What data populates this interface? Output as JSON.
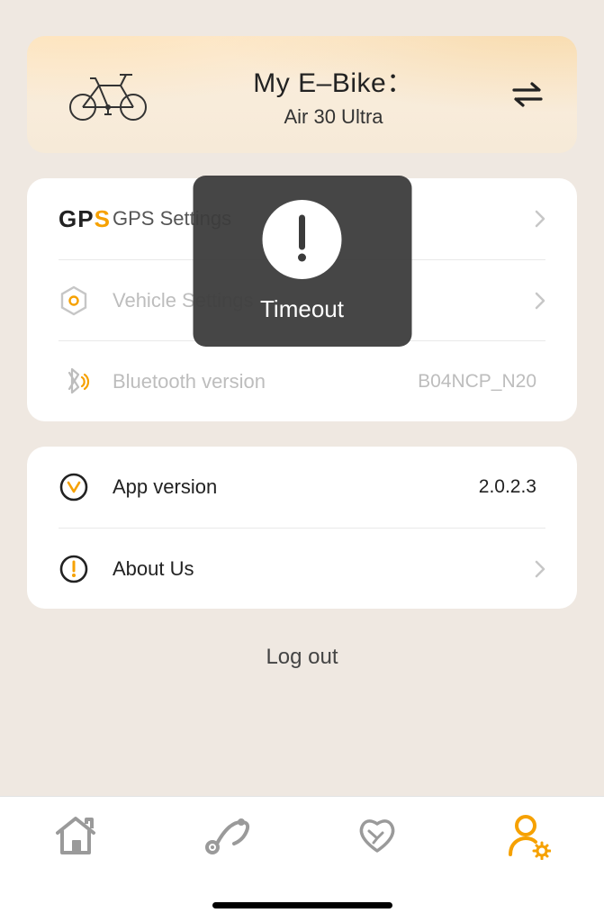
{
  "header": {
    "title": "My E–Bike：",
    "model": "Air 30 Ultra"
  },
  "settings": {
    "gps_label": "GPS Settings",
    "vehicle_label": "Vehicle Settings",
    "bt_label": "Bluetooth version",
    "bt_value": "B04NCP_N20"
  },
  "info": {
    "app_version_label": "App version",
    "app_version_value": "2.0.2.3",
    "about_label": "About Us"
  },
  "logout_label": "Log out",
  "toast": {
    "message": "Timeout"
  }
}
